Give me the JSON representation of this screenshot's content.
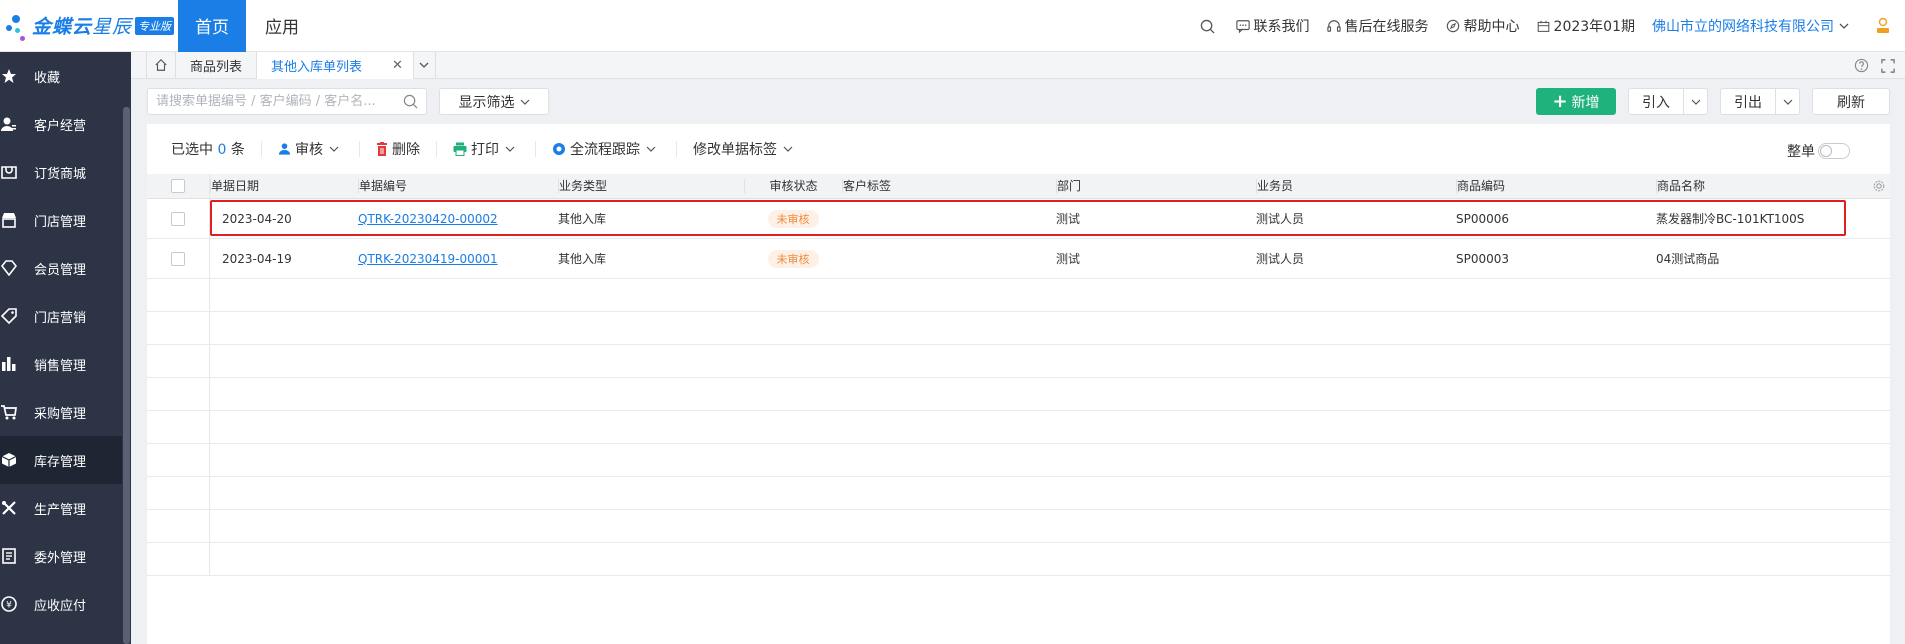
{
  "header": {
    "logo_main": "金蝶云",
    "logo_sub": "星辰",
    "logo_badge": "专业版",
    "nav_home": "首页",
    "nav_app": "应用",
    "contact": "联系我们",
    "service": "售后在线服务",
    "help": "帮助中心",
    "period": "2023年01期",
    "company": "佛山市立的网络科技有限公司"
  },
  "sidebar": {
    "items": [
      {
        "label": "收藏",
        "icon": "star-icon"
      },
      {
        "label": "客户经营",
        "icon": "user-icon"
      },
      {
        "label": "订货商城",
        "icon": "mall-icon"
      },
      {
        "label": "门店管理",
        "icon": "store-icon"
      },
      {
        "label": "会员管理",
        "icon": "diamond-icon"
      },
      {
        "label": "门店营销",
        "icon": "tag-icon"
      },
      {
        "label": "销售管理",
        "icon": "bar-chart-icon"
      },
      {
        "label": "采购管理",
        "icon": "cart-icon"
      },
      {
        "label": "库存管理",
        "icon": "box-icon"
      },
      {
        "label": "生产管理",
        "icon": "tools-icon"
      },
      {
        "label": "委外管理",
        "icon": "document-icon"
      },
      {
        "label": "应收应付",
        "icon": "coin-icon"
      }
    ],
    "active_index": 8
  },
  "tabs": {
    "items": [
      {
        "label": "商品列表"
      },
      {
        "label": "其他入库单列表"
      }
    ],
    "active_index": 1
  },
  "toolbar": {
    "search_placeholder": "请搜索单据编号 / 客户编码 / 客户名...",
    "filter_label": "显示筛选",
    "new_label": "新增",
    "import_label": "引入",
    "export_label": "引出",
    "refresh_label": "刷新"
  },
  "actions": {
    "selected_prefix": "已选中",
    "selected_count": "0",
    "selected_suffix": "条",
    "audit": "审核",
    "delete": "删除",
    "print": "打印",
    "track": "全流程跟踪",
    "edit_tag": "修改单据标签",
    "whole_label": "整单"
  },
  "table": {
    "columns": [
      "单据日期",
      "单据编号",
      "业务类型",
      "审核状态",
      "客户标签",
      "部门",
      "业务员",
      "商品编码",
      "商品名称"
    ],
    "rows": [
      {
        "date": "2023-04-20",
        "code": "QTRK-20230420-00002",
        "type": "其他入库",
        "status": "未审核",
        "tag": "",
        "dept": "测试",
        "staff": "测试人员",
        "sku": "SP00006",
        "name": "蒸发器制冷BC-101KT100S"
      },
      {
        "date": "2023-04-19",
        "code": "QTRK-20230419-00001",
        "type": "其他入库",
        "status": "未审核",
        "tag": "",
        "dept": "测试",
        "staff": "测试人员",
        "sku": "SP00003",
        "name": "04测试商品"
      }
    ]
  },
  "colors": {
    "brand": "#1a7ee6",
    "sidebar": "#2c3446",
    "new_button": "#1fb27c",
    "status_text": "#f08b3a",
    "highlight": "#e02020"
  }
}
